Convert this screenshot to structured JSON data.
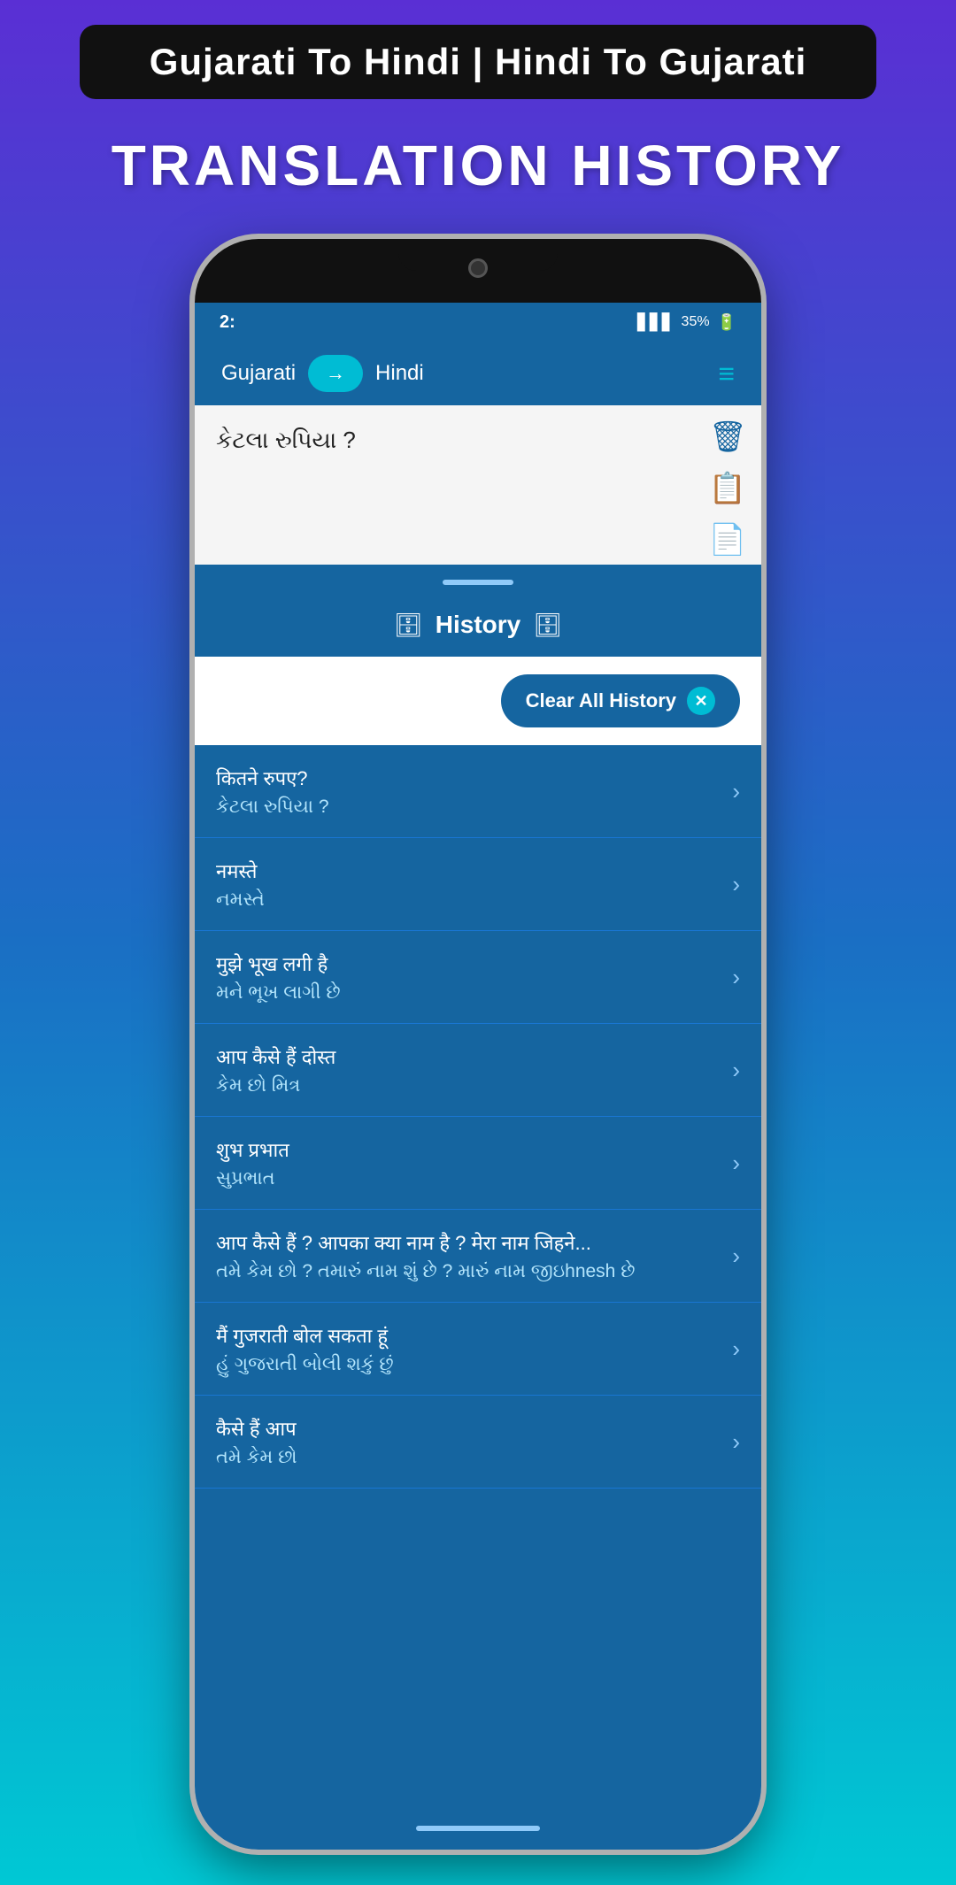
{
  "banner": {
    "text": "Gujarati To Hindi  |  Hindi To Gujarati"
  },
  "main_title": "TRANSLATION HISTORY",
  "phone": {
    "status_bar": {
      "time": "2:",
      "battery": "35%"
    },
    "header": {
      "lang_from": "Gujarati",
      "lang_to": "Hindi",
      "arrow_icon": "→"
    },
    "input_area": {
      "text": "કેટલા રુપિયા ?"
    },
    "history": {
      "title": "History",
      "clear_button": "Clear All History",
      "items": [
        {
          "line1": "कितने रुपए?",
          "line2": "કેટલા રુપિયા ?"
        },
        {
          "line1": "नमस्ते",
          "line2": "નમસ્તે"
        },
        {
          "line1": "मुझे भूख लगी है",
          "line2": "મને ભૂખ લાગી છે"
        },
        {
          "line1": "आप कैसे हैं दोस्त",
          "line2": "કેમ છો મિત્ર"
        },
        {
          "line1": "शुभ प्रभात",
          "line2": "સુપ્રભાત"
        },
        {
          "line1": "आप कैसे हैं ? आपका क्या नाम है ? मेरा नाम जिहने...",
          "line2": "તમે કેમ છો ? તમારું નામ શું છે ? મારું નામ જીઇhnesh છે"
        },
        {
          "line1": "मैं गुजराती बोल सकता हूं",
          "line2": "હું ગુજરાતી બોલી શકું છું"
        },
        {
          "line1": "कैसे हैं आप",
          "line2": "તમે કેમ છો"
        }
      ]
    }
  }
}
